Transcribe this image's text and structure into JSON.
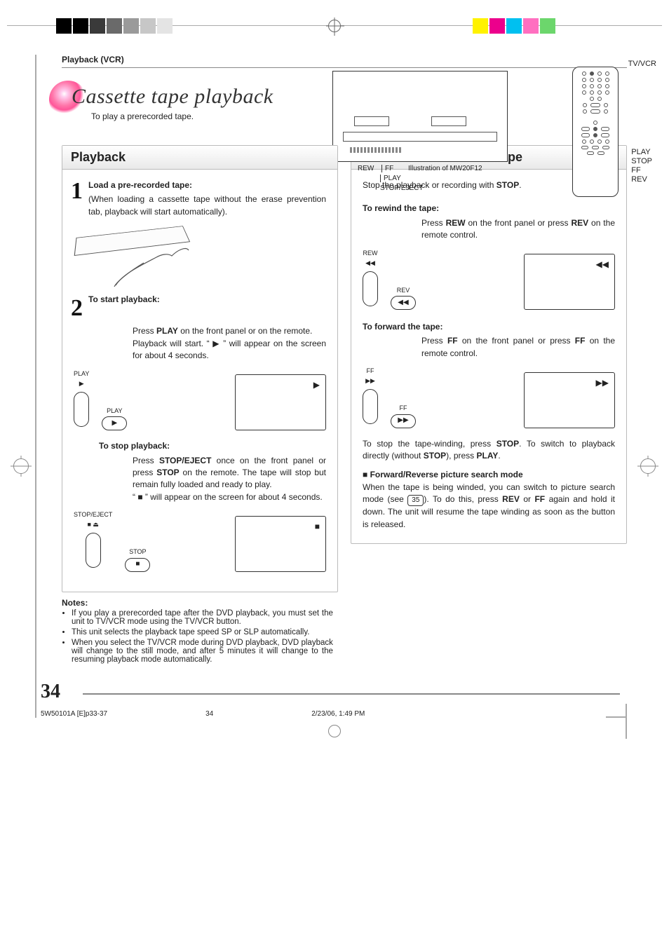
{
  "header": {
    "section": "Playback (VCR)"
  },
  "title": {
    "main": "Cassette tape playback",
    "sub": "To play a prerecorded tape."
  },
  "device": {
    "remote_top": "TV/VCR",
    "remote_labels": [
      "PLAY",
      "STOP",
      "FF",
      "REV"
    ],
    "front_labels": {
      "rew": "REW",
      "ff": "FF",
      "play": "PLAY",
      "stop": "STOP/EJECT"
    },
    "illus": "Illustration of MW20F12"
  },
  "left_panel": {
    "head": "Playback",
    "step1": {
      "heading": "Load a pre-recorded tape:",
      "body": "(When loading a cassette tape without the erase prevention tab, playback will start automatically)."
    },
    "step2": {
      "heading": "To start playback:",
      "l1": "Press ",
      "l1b": "PLAY",
      "l1c": " on the front panel or on the remote.",
      "l2a": "Playback will start. “ ",
      "l2b": " ” will appear on the screen for about 4 seconds.",
      "btn_play_top": "PLAY",
      "btn_play_bot": "▶",
      "remote_play_top": "PLAY",
      "screen_icon": "▶"
    },
    "stop": {
      "heading": "To stop playback:",
      "p1a": "Press ",
      "p1b": "STOP/EJECT",
      "p1c": " once on the front panel or press ",
      "p1d": "STOP",
      "p1e": " on the remote. The tape will stop but remain fully loaded and ready to play.",
      "p2a": "“ ",
      "p2b": " ” will appear on the screen for about 4 seconds.",
      "btn_stop_top": "STOP/EJECT",
      "btn_stop_bot": "■ ⏏",
      "remote_stop_top": "STOP",
      "screen_icon": "■"
    },
    "notes_title": "Notes:",
    "notes": [
      "If you play a prerecorded tape after the DVD playback, you must set the unit to TV/VCR mode using the TV/VCR button.",
      "This unit selects the playback tape speed SP or SLP automatically.",
      "When you select the TV/VCR mode during DVD playback, DVD playback will change to the still mode, and after 5 minutes it will change to the resuming playback mode automatically."
    ]
  },
  "right_panel": {
    "head": "Rewind or forward the tape",
    "intro_a": "Stop the playback or recording with ",
    "intro_b": "STOP",
    "intro_c": ".",
    "rewind_head": "To rewind the tape:",
    "rewind_a": "Press ",
    "rewind_b": "REW",
    "rewind_c": " on the front panel or press ",
    "rewind_d": "REV",
    "rewind_e": " on the remote control.",
    "btn_rew_top": "REW",
    "btn_rew_bot": "◀◀",
    "remote_rev_top": "REV",
    "screen_rew": "◀◀",
    "forward_head": "To forward the tape:",
    "fwd_a": "Press ",
    "fwd_b": "FF",
    "fwd_c": " on the front panel or press ",
    "fwd_d": "FF",
    "fwd_e": " on the remote control.",
    "btn_ff_top": "FF",
    "btn_ff_bot": "▶▶",
    "remote_ff_top": "FF",
    "screen_ff": "▶▶",
    "stopwind_a": "To stop the tape-winding, press ",
    "stopwind_b": "STOP",
    "stopwind_c": ". To switch to playback directly (without ",
    "stopwind_d": "STOP",
    "stopwind_e": "), press ",
    "stopwind_f": "PLAY",
    "stopwind_g": ".",
    "mode_bullet": "■",
    "mode_head": "Forward/Reverse picture search mode",
    "mode_a": "When the tape is being winded, you can switch to picture search mode (see ",
    "mode_page": "35",
    "mode_b": "). To do this, press ",
    "mode_c": "REV",
    "mode_d": " or ",
    "mode_e": "FF",
    "mode_f": " again and hold it down. The unit will resume the tape winding as soon as the button is released."
  },
  "footer": {
    "pagenum": "34",
    "file": "5W50101A [E]p33-37",
    "pg": "34",
    "date": "2/23/06, 1:49 PM"
  }
}
